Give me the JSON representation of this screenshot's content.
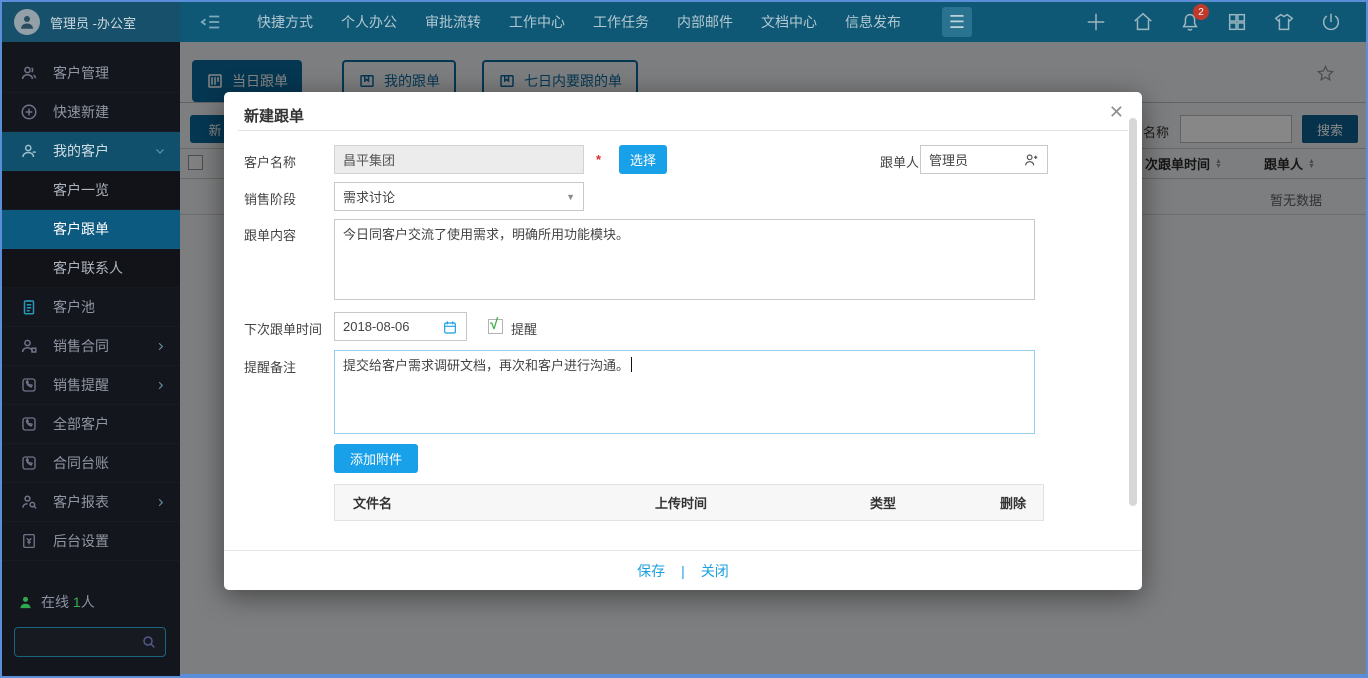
{
  "navbar": {
    "user": "管理员 -办公室",
    "items": [
      {
        "label": "快捷方式"
      },
      {
        "label": "个人办公"
      },
      {
        "label": "审批流转"
      },
      {
        "label": "工作中心"
      },
      {
        "label": "工作任务"
      },
      {
        "label": "内部邮件"
      },
      {
        "label": "文档中心"
      },
      {
        "label": "信息发布"
      }
    ],
    "burger": "☰",
    "notification_count": "2"
  },
  "sidebar": {
    "items": [
      {
        "label": "客户管理"
      },
      {
        "label": "快速新建"
      },
      {
        "label": "我的客户"
      },
      {
        "label": "客户一览"
      },
      {
        "label": "客户跟单"
      },
      {
        "label": "客户联系人"
      },
      {
        "label": "客户池"
      },
      {
        "label": "销售合同"
      },
      {
        "label": "销售提醒"
      },
      {
        "label": "全部客户"
      },
      {
        "label": "合同台账"
      },
      {
        "label": "客户报表"
      },
      {
        "label": "后台设置"
      }
    ],
    "online_label": "在线",
    "online_count": "1",
    "online_suffix": "人"
  },
  "content": {
    "tabs": [
      {
        "label": "当日跟单"
      },
      {
        "label": "我的跟单"
      },
      {
        "label": "七日内要跟的单"
      }
    ],
    "new_button": "新",
    "search_label": "名称",
    "search_button": "搜索",
    "columns": [
      {
        "label": "次跟单时间"
      },
      {
        "label": "跟单人"
      }
    ],
    "empty_text": "暂无数据"
  },
  "modal": {
    "title": "新建跟单",
    "close": "✕",
    "customer": {
      "label": "客户名称",
      "value": "昌平集团",
      "required": "*",
      "choose_button": "选择"
    },
    "follower": {
      "label": "跟单人",
      "value": "管理员"
    },
    "stage": {
      "label": "销售阶段",
      "value": "需求讨论"
    },
    "content_field": {
      "label": "跟单内容",
      "value": "今日同客户交流了使用需求，明确所用功能模块。"
    },
    "next_time": {
      "label": "下次跟单时间",
      "value": "2018-08-06"
    },
    "remind": {
      "label": "提醒",
      "checked": "√"
    },
    "remark": {
      "label": "提醒备注",
      "value": "提交给客户需求调研文档，再次和客户进行沟通。"
    },
    "attachment": {
      "add_button": "添加附件",
      "columns": [
        {
          "label": "文件名"
        },
        {
          "label": "上传时间"
        },
        {
          "label": "类型"
        },
        {
          "label": "删除"
        }
      ]
    },
    "footer": {
      "save": "保存",
      "separator": "|",
      "close": "关闭"
    }
  },
  "colors": {
    "navbar": "#0e5875",
    "navbar_left": "#17506a",
    "sidebar": "#14161d",
    "sidebar_active": "#0c5a80",
    "tab_teal": "#0a689b",
    "accent_blue": "#18a0e8",
    "search_button": "#0d5f8e",
    "link_blue": "#1a9fe0",
    "badge_red": "#c0392b",
    "check_green": "#3fae49",
    "online_green": "#2fa84f",
    "required_red": "#e02a2a"
  }
}
